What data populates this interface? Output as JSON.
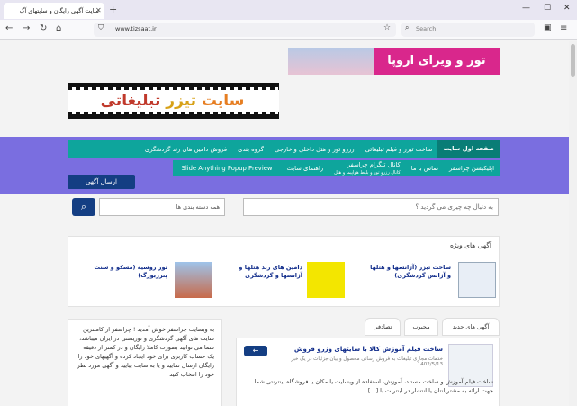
{
  "browser": {
    "tab_title": "سایت آگهی رایگان و سایتهای آگ",
    "tab_close": "✕",
    "new_tab": "+",
    "url": "www.tizsaat.ir",
    "search_placeholder": "Search",
    "window_controls": [
      "—",
      "☐",
      "✕"
    ]
  },
  "top_ad": {
    "text": "تور و ویزای اروپا"
  },
  "logo": {
    "part1": "سایت",
    "part2": "تیزر",
    "part3": "تبلیغاتی"
  },
  "menu": {
    "row1": [
      "صفحه اول سایت",
      "ساخت تیزر و فیلم تبلیغاتی",
      "رزرو تور و هتل داخلی و خارجی",
      "گروه بندی",
      "فروش دامین های رند گردشگری"
    ],
    "row2": [
      "اپلیکیشن چراسفر",
      "تماس با ما",
      "کانال تلگرام چراسفر",
      "راهنمای سایت"
    ],
    "row2_sub": "کانال رزرو تور و بلیط هواپیما و هتل",
    "row3": [
      "Slide Anything Popup Preview"
    ],
    "send_ad": "ارسال آگهی"
  },
  "search": {
    "button_icon": "search-icon",
    "placeholder": "به دنبال چه چیزی می گردید ؟",
    "category": "همه دسته بندی ها"
  },
  "featured": {
    "title": "آگهی های ویژه",
    "items": [
      {
        "text": "ساخت تیزر (آژانسها و هتلها و آژانس گردشگری)"
      },
      {
        "text": "دامین های رند هتلها و آژانسها و گردشگری"
      },
      {
        "text": "تور روسیه (مسکو و سنت پترزبورگ)"
      }
    ]
  },
  "sidebar": {
    "text": "به وبسایت چراسفر خوش آمدید ! چراسفر از کاملترین سایت های آگهی گردشگری و توریستی در ایران میباشد، شما می توانید بصورت کاملا رایگان و در کمتر از دقیقه یک حساب کاربری برای خود ایجاد کرده و آگهیهای خود را رایگان ارسال نمایید و یا به سایت بیایید و آگهی مورد نظر خود را انتخاب کنید"
  },
  "tabs": [
    "آگهی های جدید",
    "محبوب",
    "تصادفی"
  ],
  "post": {
    "title": "ساخت فیلم آموزش کالا با سایتهای وزرو فروش",
    "meta": "خدمات مجازی تبلیغات به فروش رسانی محصول و بیان جزئیات در یک خبر",
    "date": "1402/5/13",
    "body": "ساخت فیلم آموزش و ساخت مستند، آموزش، استفاده از وبسایت یا مکان یا فروشگاه اینترنتی شما جهت ارائه به مشتریانتان یا انتشار در اینترنت با [...]",
    "arrow": "←"
  }
}
